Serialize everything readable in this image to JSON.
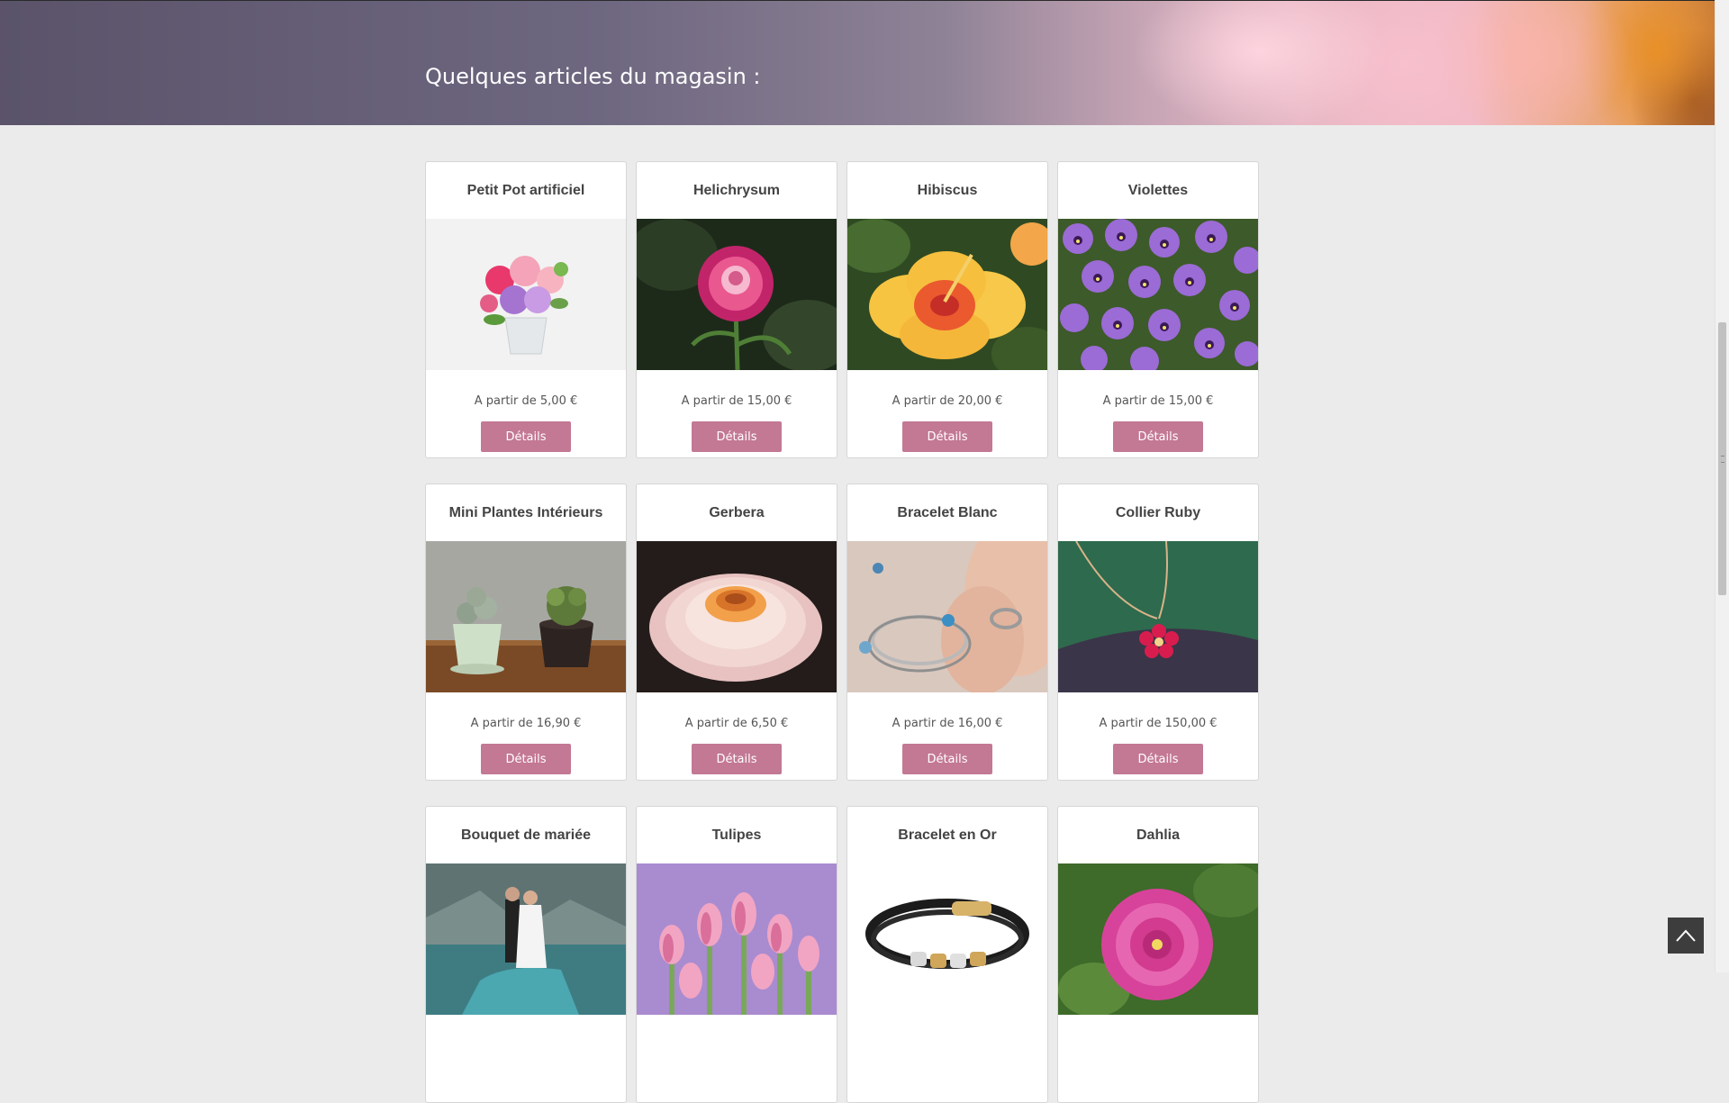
{
  "header": {
    "title": "Quelques articles du magasin :"
  },
  "products": [
    {
      "name": "Petit Pot artificiel",
      "price": "A partir de 5,00 €",
      "button": "Détails",
      "image_icon": "artificial-flower-pot-image"
    },
    {
      "name": "Helichrysum",
      "price": "A partir de 15,00 €",
      "button": "Détails",
      "image_icon": "helichrysum-image"
    },
    {
      "name": "Hibiscus",
      "price": "A partir de 20,00 €",
      "button": "Détails",
      "image_icon": "hibiscus-image"
    },
    {
      "name": "Violettes",
      "price": "A partir de 15,00 €",
      "button": "Détails",
      "image_icon": "violets-image"
    },
    {
      "name": "Mini Plantes Intérieurs",
      "price": "A partir de 16,90 €",
      "button": "Détails",
      "image_icon": "mini-plants-image"
    },
    {
      "name": "Gerbera",
      "price": "A partir de 6,50 €",
      "button": "Détails",
      "image_icon": "gerbera-image"
    },
    {
      "name": "Bracelet Blanc",
      "price": "A partir de 16,00 €",
      "button": "Détails",
      "image_icon": "white-bracelet-image"
    },
    {
      "name": "Collier Ruby",
      "price": "A partir de 150,00 €",
      "button": "Détails",
      "image_icon": "ruby-necklace-image"
    },
    {
      "name": "Bouquet de mariée",
      "price": "",
      "button": "",
      "image_icon": "bridal-bouquet-image"
    },
    {
      "name": "Tulipes",
      "price": "",
      "button": "",
      "image_icon": "tulips-image"
    },
    {
      "name": "Bracelet en Or",
      "price": "",
      "button": "",
      "image_icon": "gold-bracelet-image"
    },
    {
      "name": "Dahlia",
      "price": "",
      "button": "",
      "image_icon": "dahlia-image"
    }
  ],
  "colors": {
    "button_bg": "#c37894",
    "page_bg": "#ebebeb",
    "card_bg": "#ffffff"
  },
  "back_to_top": {
    "icon": "chevron-up-icon"
  }
}
